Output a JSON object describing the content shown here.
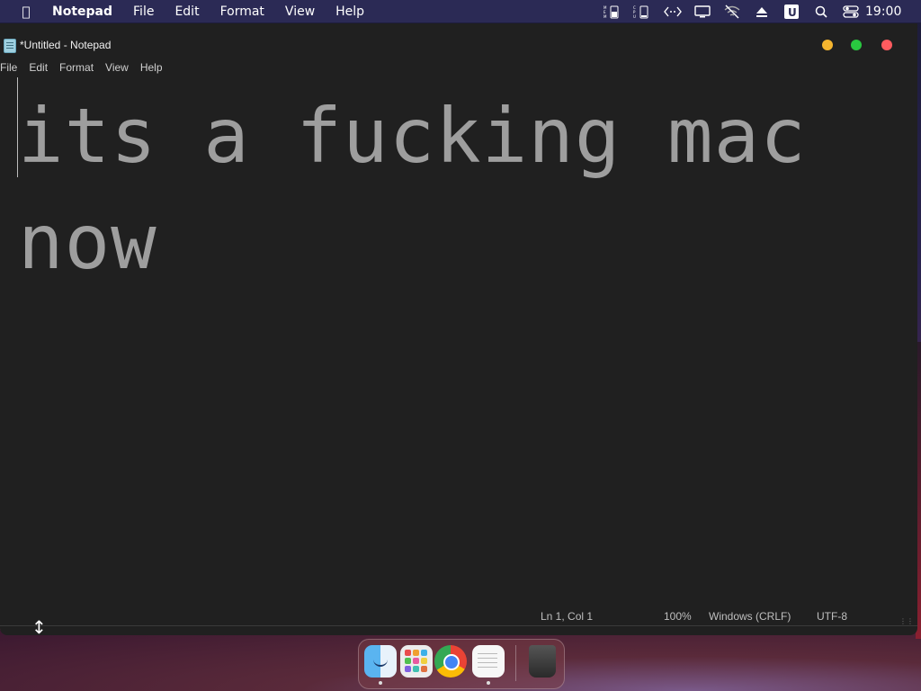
{
  "menubar": {
    "app_name": "Notepad",
    "items": [
      "File",
      "Edit",
      "Format",
      "View",
      "Help"
    ],
    "clock": "19:00",
    "status_icons": [
      "memory-monitor-icon",
      "cpu-monitor-icon",
      "code-icon",
      "display-icon",
      "wifi-off-icon",
      "eject-icon",
      "u-app-icon",
      "search-icon",
      "control-center-icon"
    ]
  },
  "window": {
    "title": "*Untitled - Notepad",
    "menu": [
      "File",
      "Edit",
      "Format",
      "View",
      "Help"
    ],
    "content": "its a fucking mac now",
    "status": {
      "position": "Ln 1, Col 1",
      "zoom": "100%",
      "line_ending": "Windows (CRLF)",
      "encoding": "UTF-8"
    }
  },
  "dock": {
    "apps": [
      "Finder",
      "Launchpad",
      "Google Chrome",
      "TextEdit",
      "Trash"
    ],
    "running": [
      "Finder",
      "TextEdit"
    ]
  },
  "colors": {
    "menubar_bg": "#2b2a55",
    "window_bg": "#202020",
    "text": "#9e9e9e",
    "traffic_min": "#f5b52f",
    "traffic_max": "#29c840",
    "traffic_close": "#ff5b5f"
  }
}
